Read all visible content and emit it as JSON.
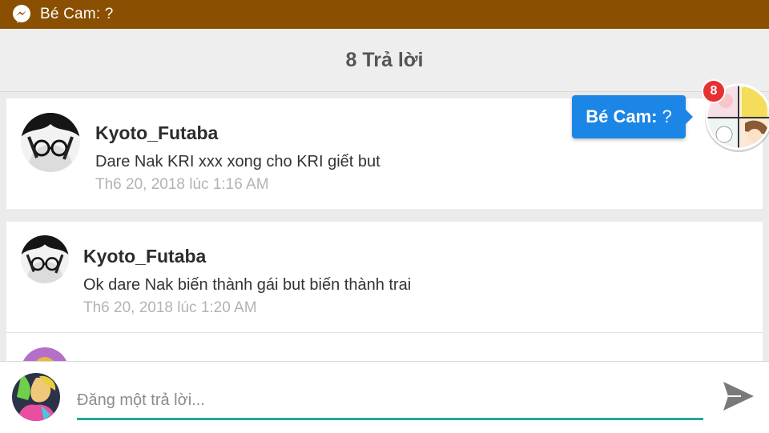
{
  "status_bar": {
    "icon": "messenger-icon",
    "text": "Bé Cam: ?",
    "background": "#8a4f00"
  },
  "header": {
    "title": "8 Trả lời"
  },
  "replies": [
    {
      "author": "Kyoto_Futaba",
      "text": "Dare Nak KRI xxx xong cho KRI giết but",
      "time": "Th6 20, 2018 lúc 1:16 AM"
    },
    {
      "author": "Kyoto_Futaba",
      "text": "Ok dare Nak biến thành gái but biến thành trai",
      "time": "Th6 20, 2018 lúc 1:20 AM"
    }
  ],
  "chat_head": {
    "badge_count": "8",
    "bubble_name": "Bé Cam:",
    "bubble_text": "?"
  },
  "composer": {
    "placeholder": "Đăng một trả lời...",
    "value": "",
    "send_icon": "send-icon",
    "accent": "#26a69a"
  }
}
